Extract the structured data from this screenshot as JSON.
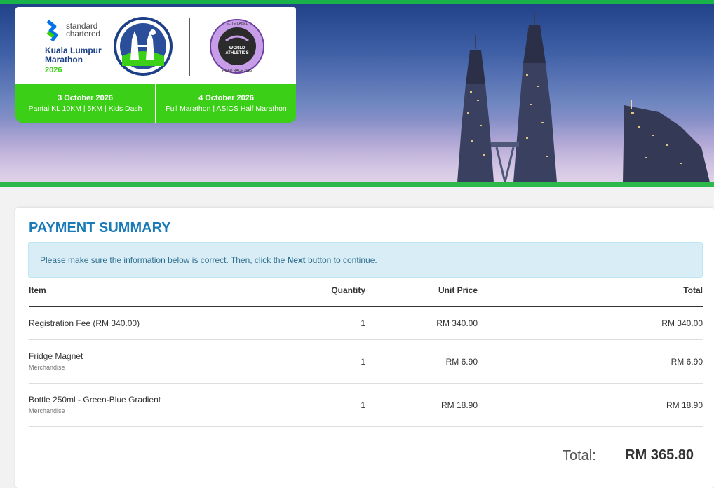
{
  "banner": {
    "sponsor": {
      "line1": "standard",
      "line2": "chartered"
    },
    "event": {
      "name_line1": "Kuala Lumpur",
      "name_line2": "Marathon",
      "year": "2026"
    },
    "badge": {
      "top_text": "ELITE LABEL",
      "name_line1": "WORLD",
      "name_line2": "ATHLETICS",
      "bottom_text": "ROAD RACE 2026"
    },
    "days": [
      {
        "date": "3 October 2026",
        "events": "Pantai KL 10KM | 5KM | Kids Dash"
      },
      {
        "date": "4 October 2026",
        "events": "Full Marathon | ASICS Half Marathon"
      }
    ]
  },
  "summary": {
    "title": "PAYMENT SUMMARY",
    "info": {
      "before": "Please make sure the information below is correct. Then, click the ",
      "bold": "Next",
      "after": " button to continue."
    },
    "columns": {
      "item": "Item",
      "quantity": "Quantity",
      "unit_price": "Unit Price",
      "total": "Total"
    },
    "rows": [
      {
        "name": "Registration Fee (RM 340.00)",
        "sub": "",
        "quantity": "1",
        "unit_price": "RM 340.00",
        "total": "RM 340.00"
      },
      {
        "name": "Fridge Magnet",
        "sub": "Merchandise",
        "quantity": "1",
        "unit_price": "RM 6.90",
        "total": "RM 6.90"
      },
      {
        "name": "Bottle 250ml - Green-Blue Gradient",
        "sub": "Merchandise",
        "quantity": "1",
        "unit_price": "RM 18.90",
        "total": "RM 18.90"
      }
    ],
    "grand_total_label": "Total:",
    "grand_total_value": "RM 365.80"
  },
  "colors": {
    "brand_green": "#3ccf17",
    "title_blue": "#1a7bb8",
    "info_bg": "#d9edf7",
    "info_text": "#31708f"
  }
}
